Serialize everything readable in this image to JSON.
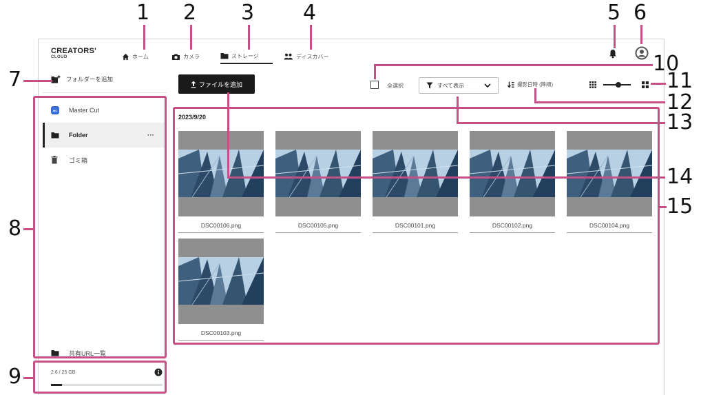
{
  "callouts": [
    "1",
    "2",
    "3",
    "4",
    "5",
    "6",
    "7",
    "8",
    "9",
    "10",
    "11",
    "12",
    "13",
    "14",
    "15"
  ],
  "app": {
    "logo": {
      "line1": "CREATORS'",
      "line2": "CLOUD"
    },
    "nav": {
      "home": "ホーム",
      "camera": "カメラ",
      "storage": "ストレージ",
      "discover": "ディスカバー"
    },
    "sidebar": {
      "add_folder": "フォルダーを追加",
      "master_cut_badge": "MC",
      "items": [
        {
          "label": "Master Cut"
        },
        {
          "label": "Folder"
        },
        {
          "label": "ゴミ箱"
        }
      ],
      "more": "···",
      "shared_urls": "共有URL一覧"
    },
    "storage": {
      "usage": "2.6 / 25 GB",
      "used_fraction": 0.1
    },
    "toolbar": {
      "add_file": "ファイルを追加",
      "select_all": "全選択",
      "filter": "すべて表示",
      "sort": "撮影日時 (降順)",
      "zoom_level": 0.55
    },
    "content": {
      "date": "2023/9/20",
      "files": [
        {
          "name": "DSC00106.png"
        },
        {
          "name": "DSC00105.png"
        },
        {
          "name": "DSC00101.png"
        },
        {
          "name": "DSC00102.png"
        },
        {
          "name": "DSC00104.png"
        },
        {
          "name": "DSC00103.png"
        }
      ]
    }
  },
  "colors": {
    "callout": "#c64f86",
    "primary_button": "#1a1a1a",
    "accent_blue": "#3a6fd8"
  },
  "icons": [
    "home-icon",
    "camera-icon",
    "folder-icon",
    "people-icon",
    "bell-icon",
    "user-icon",
    "folder-add-icon",
    "upload-icon",
    "checkbox-icon",
    "filter-icon",
    "chevron-down-icon",
    "sort-icon",
    "grid-small-icon",
    "grid-large-icon",
    "trash-icon",
    "info-icon"
  ]
}
